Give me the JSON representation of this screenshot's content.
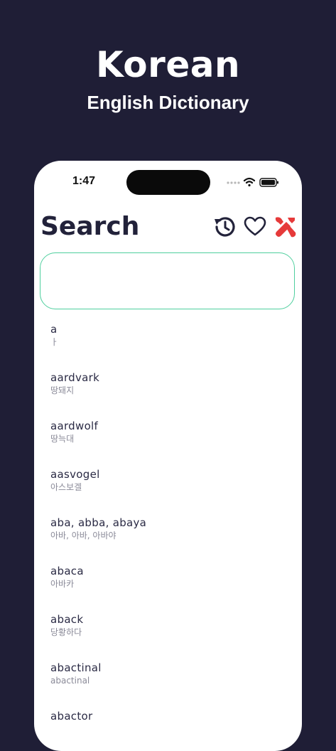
{
  "hero": {
    "title": "Korean",
    "subtitle": "English Dictionary"
  },
  "status_bar": {
    "time": "1:47"
  },
  "header": {
    "title": "Search"
  },
  "search": {
    "value": "",
    "placeholder": ""
  },
  "colors": {
    "background": "#1f1e36",
    "accent_border": "#4fcf9e",
    "tools_icon": "#e63a3a",
    "text_dark": "#22223a"
  },
  "icons": [
    "history-icon",
    "heart-icon",
    "tools-icon"
  ],
  "entries": [
    {
      "word": "a",
      "translation": "ㅏ"
    },
    {
      "word": "aardvark",
      "translation": "땅돼지"
    },
    {
      "word": "aardwolf",
      "translation": "땅늑대"
    },
    {
      "word": "aasvogel",
      "translation": "아스보겔"
    },
    {
      "word": "aba, abba, abaya",
      "translation": "아바, 아바, 아바야"
    },
    {
      "word": "abaca",
      "translation": "아바카"
    },
    {
      "word": "aback",
      "translation": "당황하다"
    },
    {
      "word": "abactinal",
      "translation": "abactinal"
    },
    {
      "word": "abactor",
      "translation": ""
    }
  ]
}
